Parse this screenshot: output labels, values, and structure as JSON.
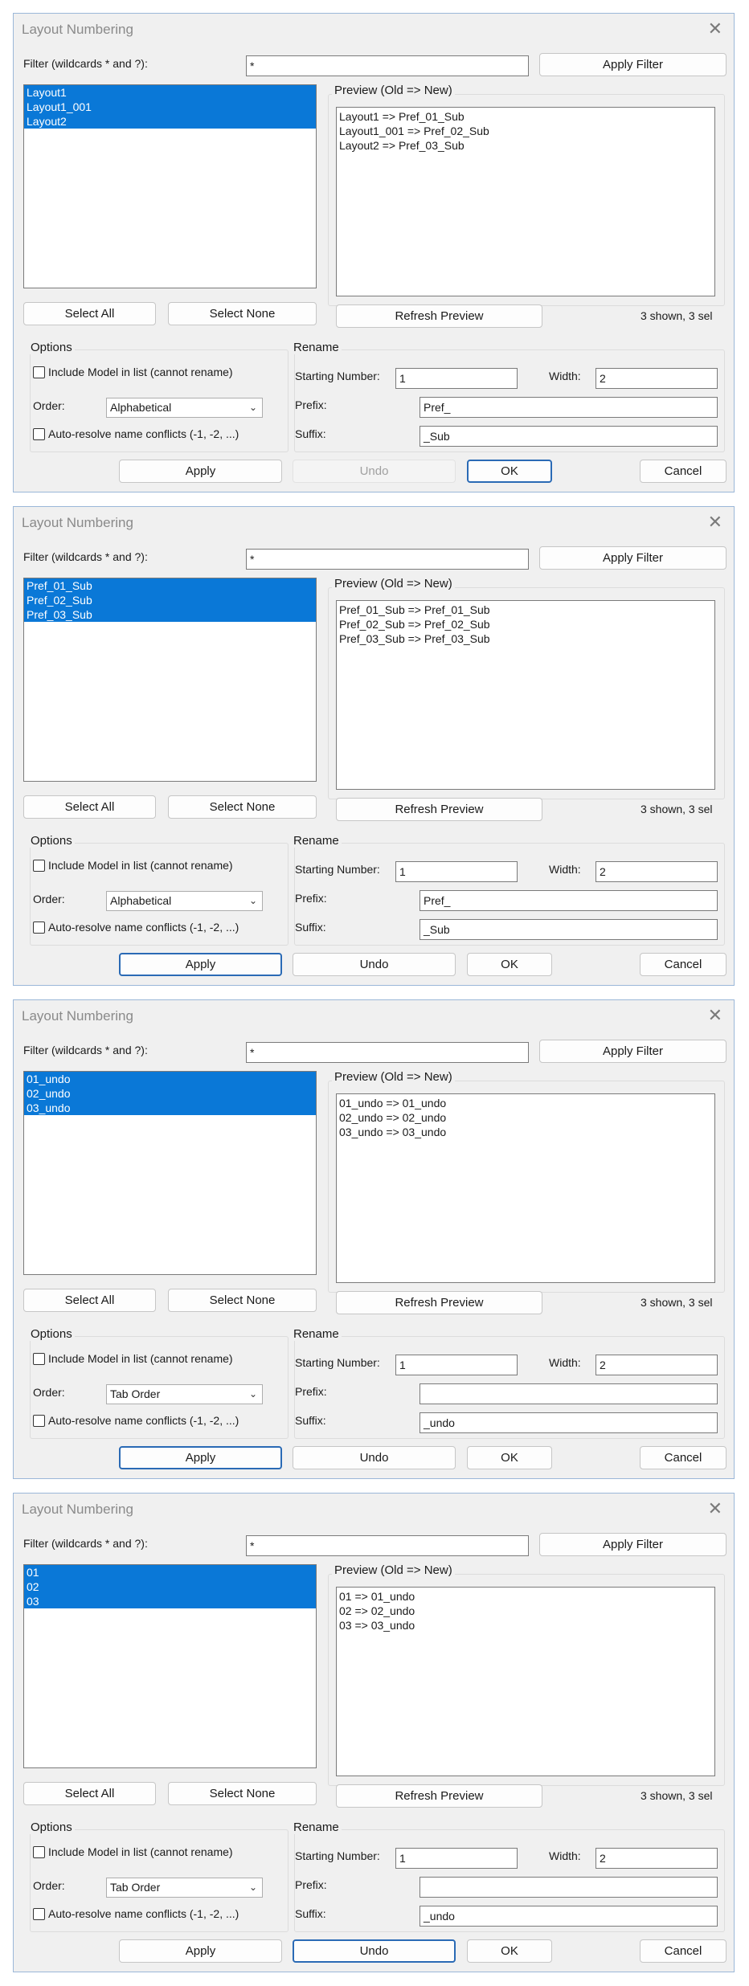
{
  "dialogs": [
    {
      "title": "Layout Numbering",
      "filter_label": "Filter (wildcards * and ?):",
      "filter_value": "*",
      "apply_filter": "Apply Filter",
      "list_items": [
        "Layout1",
        "Layout1_001",
        "Layout2"
      ],
      "preview_label": "Preview (Old  =>  New)",
      "preview_lines": [
        "Layout1  =>  Pref_01_Sub",
        "Layout1_001  =>  Pref_02_Sub",
        "Layout2  =>  Pref_03_Sub"
      ],
      "select_all": "Select All",
      "select_none": "Select None",
      "refresh_preview": "Refresh Preview",
      "count_text": "3 shown, 3 sel",
      "options_label": "Options",
      "include_model": "Include Model in list (cannot rename)",
      "order_label": "Order:",
      "order_value": "Alphabetical",
      "auto_resolve": "Auto-resolve name conflicts (-1, -2, ...)",
      "rename_label": "Rename",
      "starting_number_label": "Starting Number:",
      "starting_number": "1",
      "width_label": "Width:",
      "width_value": "2",
      "prefix_label": "Prefix:",
      "prefix_value": "Pref_",
      "suffix_label": "Suffix:",
      "suffix_value": "_Sub",
      "apply": "Apply",
      "undo": "Undo",
      "ok": "OK",
      "cancel": "Cancel",
      "undo_enabled": false,
      "focused_button": "ok"
    },
    {
      "title": "Layout Numbering",
      "filter_label": "Filter (wildcards * and ?):",
      "filter_value": "*",
      "apply_filter": "Apply Filter",
      "list_items": [
        "Pref_01_Sub",
        "Pref_02_Sub",
        "Pref_03_Sub"
      ],
      "preview_label": "Preview (Old  =>  New)",
      "preview_lines": [
        "Pref_01_Sub  =>  Pref_01_Sub",
        "Pref_02_Sub  =>  Pref_02_Sub",
        "Pref_03_Sub  =>  Pref_03_Sub"
      ],
      "select_all": "Select All",
      "select_none": "Select None",
      "refresh_preview": "Refresh Preview",
      "count_text": "3 shown, 3 sel",
      "options_label": "Options",
      "include_model": "Include Model in list (cannot rename)",
      "order_label": "Order:",
      "order_value": "Alphabetical",
      "auto_resolve": "Auto-resolve name conflicts (-1, -2, ...)",
      "rename_label": "Rename",
      "starting_number_label": "Starting Number:",
      "starting_number": "1",
      "width_label": "Width:",
      "width_value": "2",
      "prefix_label": "Prefix:",
      "prefix_value": "Pref_",
      "suffix_label": "Suffix:",
      "suffix_value": "_Sub",
      "apply": "Apply",
      "undo": "Undo",
      "ok": "OK",
      "cancel": "Cancel",
      "undo_enabled": true,
      "focused_button": "apply"
    },
    {
      "title": "Layout Numbering",
      "filter_label": "Filter (wildcards * and ?):",
      "filter_value": "*",
      "apply_filter": "Apply Filter",
      "list_items": [
        "01_undo",
        "02_undo",
        "03_undo"
      ],
      "preview_label": "Preview (Old  =>  New)",
      "preview_lines": [
        "01_undo  =>  01_undo",
        "02_undo  =>  02_undo",
        "03_undo  =>  03_undo"
      ],
      "select_all": "Select All",
      "select_none": "Select None",
      "refresh_preview": "Refresh Preview",
      "count_text": "3 shown, 3 sel",
      "options_label": "Options",
      "include_model": "Include Model in list (cannot rename)",
      "order_label": "Order:",
      "order_value": "Tab Order",
      "auto_resolve": "Auto-resolve name conflicts (-1, -2, ...)",
      "rename_label": "Rename",
      "starting_number_label": "Starting Number:",
      "starting_number": "1",
      "width_label": "Width:",
      "width_value": "2",
      "prefix_label": "Prefix:",
      "prefix_value": "",
      "suffix_label": "Suffix:",
      "suffix_value": "_undo",
      "apply": "Apply",
      "undo": "Undo",
      "ok": "OK",
      "cancel": "Cancel",
      "undo_enabled": true,
      "focused_button": "apply"
    },
    {
      "title": "Layout Numbering",
      "filter_label": "Filter (wildcards * and ?):",
      "filter_value": "*",
      "apply_filter": "Apply Filter",
      "list_items": [
        "01",
        "02",
        "03"
      ],
      "preview_label": "Preview (Old  =>  New)",
      "preview_lines": [
        "01  =>  01_undo",
        "02  =>  02_undo",
        "03  =>  03_undo"
      ],
      "select_all": "Select All",
      "select_none": "Select None",
      "refresh_preview": "Refresh Preview",
      "count_text": "3 shown, 3 sel",
      "options_label": "Options",
      "include_model": "Include Model in list (cannot rename)",
      "order_label": "Order:",
      "order_value": "Tab Order",
      "auto_resolve": "Auto-resolve name conflicts (-1, -2, ...)",
      "rename_label": "Rename",
      "starting_number_label": "Starting Number:",
      "starting_number": "1",
      "width_label": "Width:",
      "width_value": "2",
      "prefix_label": "Prefix:",
      "prefix_value": "",
      "suffix_label": "Suffix:",
      "suffix_value": "_undo",
      "apply": "Apply",
      "undo": "Undo",
      "ok": "OK",
      "cancel": "Cancel",
      "undo_enabled": true,
      "focused_button": "undo"
    }
  ]
}
